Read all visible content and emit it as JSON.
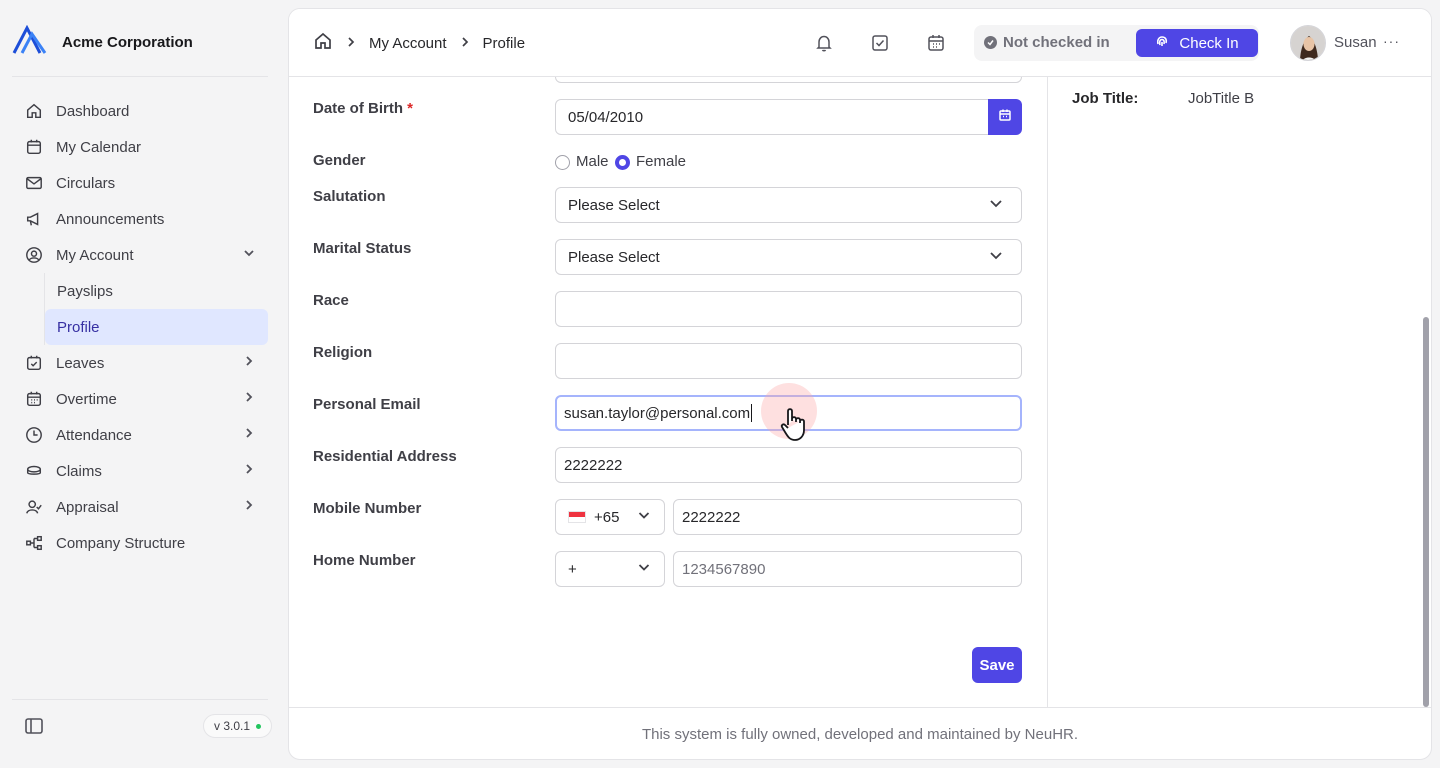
{
  "brand": {
    "name": "Acme Corporation"
  },
  "sidebar": {
    "items": [
      {
        "label": "Dashboard",
        "icon": "home-icon"
      },
      {
        "label": "My Calendar",
        "icon": "calendar-icon"
      },
      {
        "label": "Circulars",
        "icon": "mail-icon"
      },
      {
        "label": "Announcements",
        "icon": "megaphone-icon"
      },
      {
        "label": "My Account",
        "icon": "user-circle-icon",
        "expanded": true,
        "children": [
          {
            "label": "Payslips"
          },
          {
            "label": "Profile",
            "active": true
          }
        ]
      },
      {
        "label": "Leaves",
        "icon": "calendar-check-icon"
      },
      {
        "label": "Overtime",
        "icon": "calendar-grid-icon"
      },
      {
        "label": "Attendance",
        "icon": "clock-icon"
      },
      {
        "label": "Claims",
        "icon": "coins-icon"
      },
      {
        "label": "Appraisal",
        "icon": "user-check-icon"
      },
      {
        "label": "Company Structure",
        "icon": "org-chart-icon"
      }
    ],
    "version": "v 3.0.1"
  },
  "header": {
    "breadcrumb": [
      "My Account",
      "Profile"
    ],
    "status": "Not checked in",
    "check_in_label": "Check In",
    "user_name": "Susan"
  },
  "form": {
    "date_of_birth": {
      "label": "Date of Birth",
      "required_mark": "*",
      "value": "05/04/2010"
    },
    "gender": {
      "label": "Gender",
      "options": [
        "Male",
        "Female"
      ],
      "selected": "Female"
    },
    "salutation": {
      "label": "Salutation",
      "value": "Please Select"
    },
    "marital_status": {
      "label": "Marital Status",
      "value": "Please Select"
    },
    "race": {
      "label": "Race",
      "value": ""
    },
    "religion": {
      "label": "Religion",
      "value": ""
    },
    "personal_email": {
      "label": "Personal Email",
      "value": "susan.taylor@personal.com"
    },
    "residential_address": {
      "label": "Residential Address",
      "value": "2222222"
    },
    "mobile_number": {
      "label": "Mobile Number",
      "country_code": "+65",
      "value": "2222222"
    },
    "home_number": {
      "label": "Home Number",
      "country_code": "+",
      "placeholder": "1234567890"
    },
    "save_label": "Save"
  },
  "details": {
    "job_title_label": "Job Title:",
    "job_title_value": "JobTitle B"
  },
  "footer": {
    "text": "This system is fully owned, developed and maintained by NeuHR."
  },
  "colors": {
    "accent": "#4f46e5",
    "active_bg": "#e0e7ff",
    "required": "#dc2626"
  }
}
